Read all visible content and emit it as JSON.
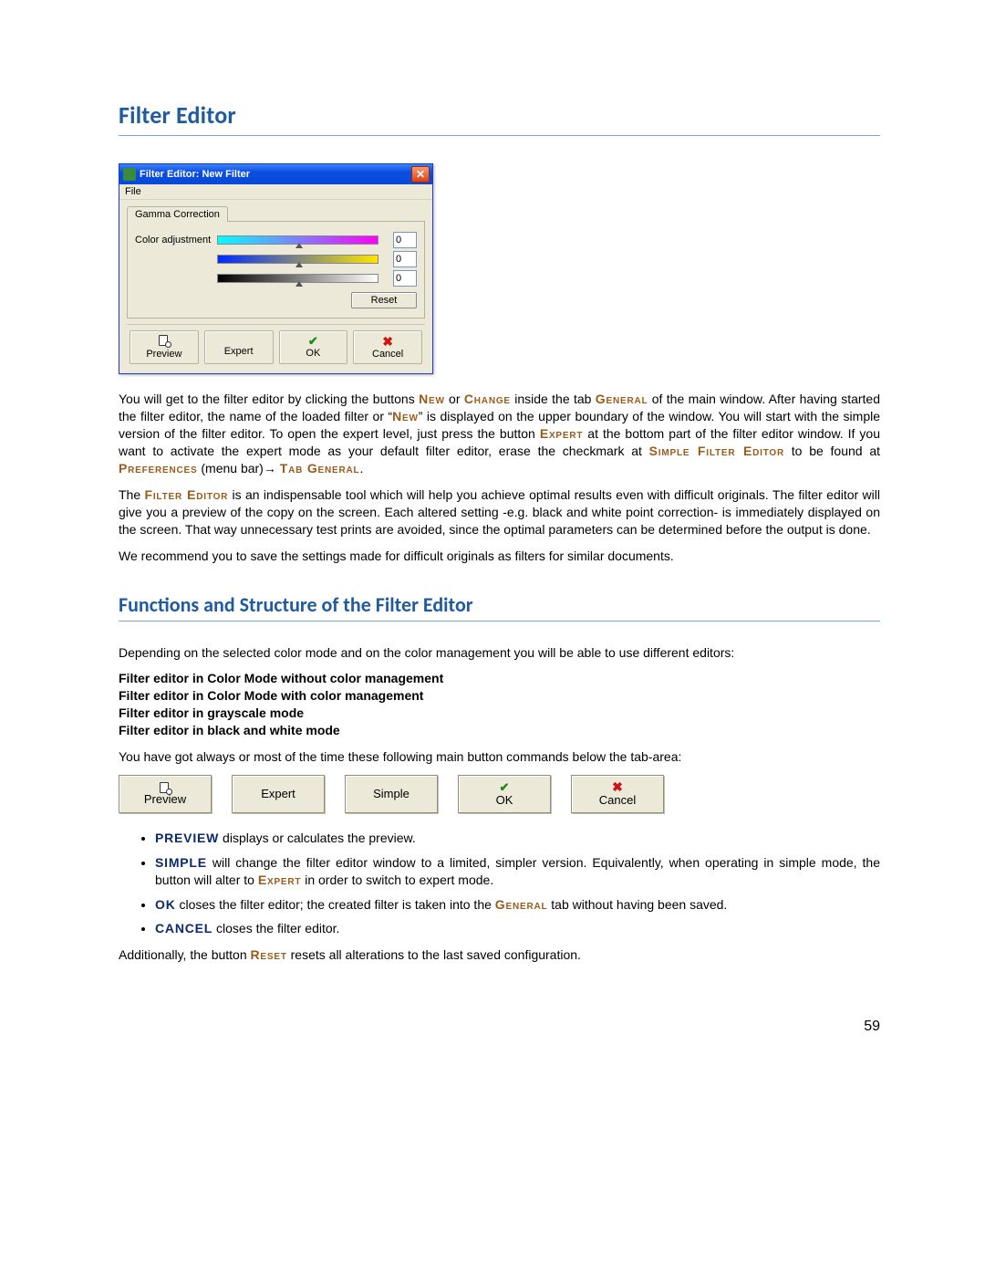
{
  "headings": {
    "h1": "Filter Editor",
    "h2": "Functions and Structure of the Filter Editor"
  },
  "dialog": {
    "title": "Filter Editor: New Filter",
    "menu_file": "File",
    "tab": "Gamma Correction",
    "label_color_adj": "Color adjustment",
    "val1": "0",
    "val2": "0",
    "val3": "0",
    "reset": "Reset",
    "btn_preview": "Preview",
    "btn_expert": "Expert",
    "btn_ok": "OK",
    "btn_cancel": "Cancel"
  },
  "para1": {
    "t1": "You will get to the filter editor by clicking the buttons ",
    "sc_new": "New",
    "t2": " or ",
    "sc_change": "Change",
    "t3": " inside the tab ",
    "sc_general": "General",
    "t4": " of the main window. After having started the filter editor, the name of the loaded filter or “",
    "sc_new2": "New",
    "t5": "” is displayed on the upper boundary of the window. You will start with the simple version of the filter editor. To open the expert level, just press the button ",
    "sc_expert": "Expert",
    "t6": " at the bottom part of the filter editor window. If you want to activate the expert mode as your default filter editor, erase the checkmark at ",
    "sc_simplefe": "Simple Filter Editor",
    "t7": " to be found at ",
    "sc_pref": "Preferences",
    "t8": " (menu bar)→ ",
    "sc_tabgen": "Tab General",
    "t9": "."
  },
  "para2": {
    "t1": "The ",
    "sc_fe": "Filter Editor",
    "t2": " is an indispensable tool which will help you achieve optimal results even with difficult originals. The filter editor will give you a preview of the copy on the screen. Each altered setting -e.g. black and white point correction- is immediately displayed on the screen. That way unnecessary test prints are avoided, since the optimal parameters can be determined before the output is done."
  },
  "para3": "We recommend you to save the settings made for difficult originals as filters for similar documents.",
  "para4": "Depending on the selected color mode and on the color management you will be able to use different editors:",
  "modes": {
    "l1": "Filter editor in Color Mode without color management",
    "l2": "Filter editor in Color Mode with color management",
    "l3": "Filter editor in grayscale mode",
    "l4": "Filter editor in black and white mode"
  },
  "para5": "You have got always or most of the time these following main button commands below the tab-area:",
  "btnrow": {
    "preview": "Preview",
    "expert": "Expert",
    "simple": "Simple",
    "ok": "OK",
    "cancel": "Cancel"
  },
  "bullets": {
    "b1_sc": "PREVIEW",
    "b1_t": " displays or calculates the preview.",
    "b2_sc": "SIMPLE",
    "b2_t1": " will change the filter editor window to a limited, simpler version. Equivalently, when operating in simple mode, the button will alter to ",
    "b2_sc2": "Expert",
    "b2_t2": " in order to switch to expert mode.",
    "b3_sc": "OK",
    "b3_t1": " closes the filter editor; the created filter is taken into the ",
    "b3_sc2": "General",
    "b3_t2": " tab without having been saved.",
    "b4_sc": "CANCEL",
    "b4_t": " closes the filter editor."
  },
  "para6": {
    "t1": "Additionally, the button ",
    "sc_reset": "Reset",
    "t2": " resets all alterations to the last saved configuration."
  },
  "page_number": "59"
}
